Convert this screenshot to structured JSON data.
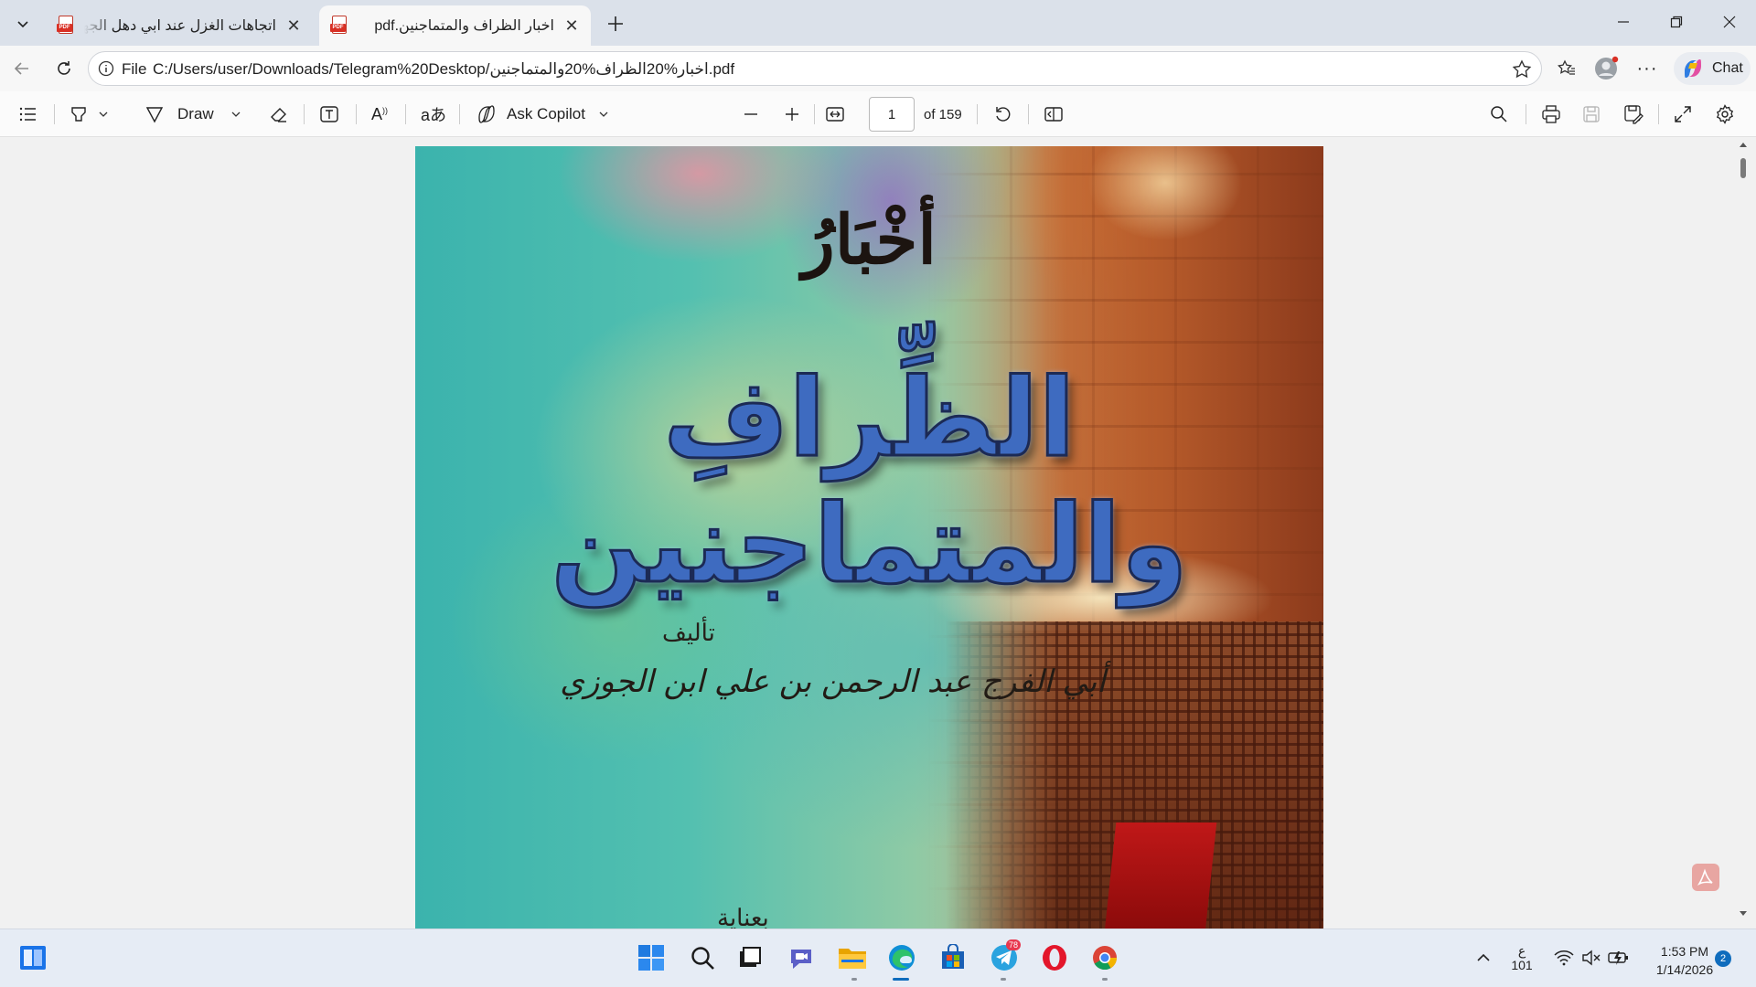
{
  "browser": {
    "tabs": [
      {
        "title": "اتجاهات الغزل عند ابي دهل الجهمي.pdf",
        "active": false,
        "icon": "pdf-icon"
      },
      {
        "title": "اخبار الظراف والمتماجنين.pdf",
        "active": true,
        "icon": "pdf-icon"
      }
    ],
    "address": {
      "scheme_label": "File",
      "url": "C:/Users/user/Downloads/Telegram%20Desktop/اخبار%20الظراف%20والمتماجنين.pdf"
    },
    "chat_label": "Chat"
  },
  "pdf_toolbar": {
    "draw_label": "Draw",
    "copilot_label": "Ask Copilot",
    "page_current": "1",
    "page_total_label": "of 159"
  },
  "document": {
    "title_top": "أخْبَارُ",
    "title_main": "الظِّرافِ والمتماجنين",
    "by_label": "تأليف",
    "author": "أبي الفرج عبد الرحمن بن علي ابن الجوزي",
    "bottom_text": "بعناية"
  },
  "taskbar": {
    "telegram_badge": "78",
    "lang_label": "ع",
    "lang_sub": "101",
    "time": "1:53 PM",
    "date": "1/14/2026",
    "notification_count": "2"
  },
  "colors": {
    "accent_blue": "#0f6cbd",
    "title_blue": "#3e6bc0",
    "opera_red": "#e3162b"
  }
}
